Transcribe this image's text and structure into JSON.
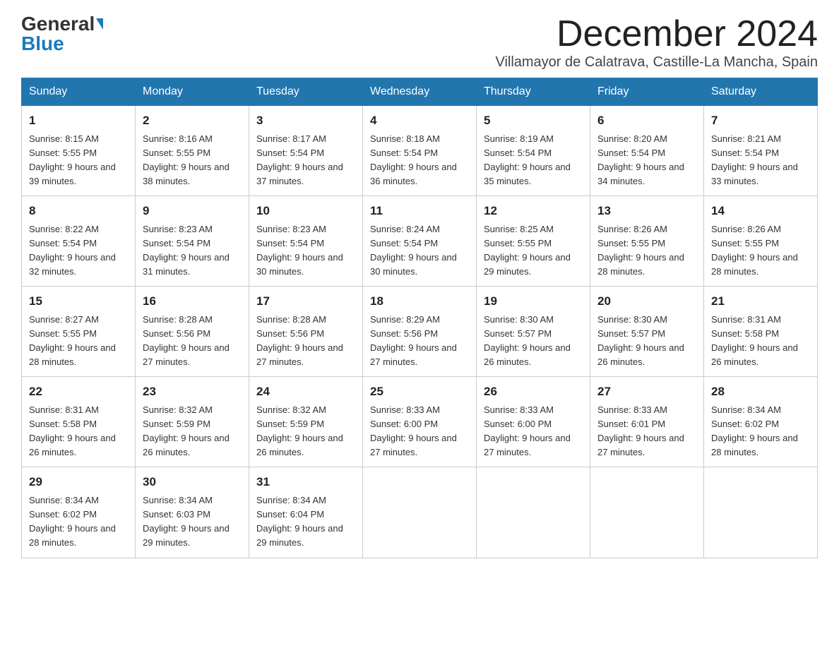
{
  "header": {
    "logo_general": "General",
    "logo_blue": "Blue",
    "month_title": "December 2024",
    "location": "Villamayor de Calatrava, Castille-La Mancha, Spain"
  },
  "days_of_week": [
    "Sunday",
    "Monday",
    "Tuesday",
    "Wednesday",
    "Thursday",
    "Friday",
    "Saturday"
  ],
  "weeks": [
    [
      {
        "day": "1",
        "sunrise": "8:15 AM",
        "sunset": "5:55 PM",
        "daylight": "9 hours and 39 minutes."
      },
      {
        "day": "2",
        "sunrise": "8:16 AM",
        "sunset": "5:55 PM",
        "daylight": "9 hours and 38 minutes."
      },
      {
        "day": "3",
        "sunrise": "8:17 AM",
        "sunset": "5:54 PM",
        "daylight": "9 hours and 37 minutes."
      },
      {
        "day": "4",
        "sunrise": "8:18 AM",
        "sunset": "5:54 PM",
        "daylight": "9 hours and 36 minutes."
      },
      {
        "day": "5",
        "sunrise": "8:19 AM",
        "sunset": "5:54 PM",
        "daylight": "9 hours and 35 minutes."
      },
      {
        "day": "6",
        "sunrise": "8:20 AM",
        "sunset": "5:54 PM",
        "daylight": "9 hours and 34 minutes."
      },
      {
        "day": "7",
        "sunrise": "8:21 AM",
        "sunset": "5:54 PM",
        "daylight": "9 hours and 33 minutes."
      }
    ],
    [
      {
        "day": "8",
        "sunrise": "8:22 AM",
        "sunset": "5:54 PM",
        "daylight": "9 hours and 32 minutes."
      },
      {
        "day": "9",
        "sunrise": "8:23 AM",
        "sunset": "5:54 PM",
        "daylight": "9 hours and 31 minutes."
      },
      {
        "day": "10",
        "sunrise": "8:23 AM",
        "sunset": "5:54 PM",
        "daylight": "9 hours and 30 minutes."
      },
      {
        "day": "11",
        "sunrise": "8:24 AM",
        "sunset": "5:54 PM",
        "daylight": "9 hours and 30 minutes."
      },
      {
        "day": "12",
        "sunrise": "8:25 AM",
        "sunset": "5:55 PM",
        "daylight": "9 hours and 29 minutes."
      },
      {
        "day": "13",
        "sunrise": "8:26 AM",
        "sunset": "5:55 PM",
        "daylight": "9 hours and 28 minutes."
      },
      {
        "day": "14",
        "sunrise": "8:26 AM",
        "sunset": "5:55 PM",
        "daylight": "9 hours and 28 minutes."
      }
    ],
    [
      {
        "day": "15",
        "sunrise": "8:27 AM",
        "sunset": "5:55 PM",
        "daylight": "9 hours and 28 minutes."
      },
      {
        "day": "16",
        "sunrise": "8:28 AM",
        "sunset": "5:56 PM",
        "daylight": "9 hours and 27 minutes."
      },
      {
        "day": "17",
        "sunrise": "8:28 AM",
        "sunset": "5:56 PM",
        "daylight": "9 hours and 27 minutes."
      },
      {
        "day": "18",
        "sunrise": "8:29 AM",
        "sunset": "5:56 PM",
        "daylight": "9 hours and 27 minutes."
      },
      {
        "day": "19",
        "sunrise": "8:30 AM",
        "sunset": "5:57 PM",
        "daylight": "9 hours and 26 minutes."
      },
      {
        "day": "20",
        "sunrise": "8:30 AM",
        "sunset": "5:57 PM",
        "daylight": "9 hours and 26 minutes."
      },
      {
        "day": "21",
        "sunrise": "8:31 AM",
        "sunset": "5:58 PM",
        "daylight": "9 hours and 26 minutes."
      }
    ],
    [
      {
        "day": "22",
        "sunrise": "8:31 AM",
        "sunset": "5:58 PM",
        "daylight": "9 hours and 26 minutes."
      },
      {
        "day": "23",
        "sunrise": "8:32 AM",
        "sunset": "5:59 PM",
        "daylight": "9 hours and 26 minutes."
      },
      {
        "day": "24",
        "sunrise": "8:32 AM",
        "sunset": "5:59 PM",
        "daylight": "9 hours and 26 minutes."
      },
      {
        "day": "25",
        "sunrise": "8:33 AM",
        "sunset": "6:00 PM",
        "daylight": "9 hours and 27 minutes."
      },
      {
        "day": "26",
        "sunrise": "8:33 AM",
        "sunset": "6:00 PM",
        "daylight": "9 hours and 27 minutes."
      },
      {
        "day": "27",
        "sunrise": "8:33 AM",
        "sunset": "6:01 PM",
        "daylight": "9 hours and 27 minutes."
      },
      {
        "day": "28",
        "sunrise": "8:34 AM",
        "sunset": "6:02 PM",
        "daylight": "9 hours and 28 minutes."
      }
    ],
    [
      {
        "day": "29",
        "sunrise": "8:34 AM",
        "sunset": "6:02 PM",
        "daylight": "9 hours and 28 minutes."
      },
      {
        "day": "30",
        "sunrise": "8:34 AM",
        "sunset": "6:03 PM",
        "daylight": "9 hours and 29 minutes."
      },
      {
        "day": "31",
        "sunrise": "8:34 AM",
        "sunset": "6:04 PM",
        "daylight": "9 hours and 29 minutes."
      },
      null,
      null,
      null,
      null
    ]
  ]
}
